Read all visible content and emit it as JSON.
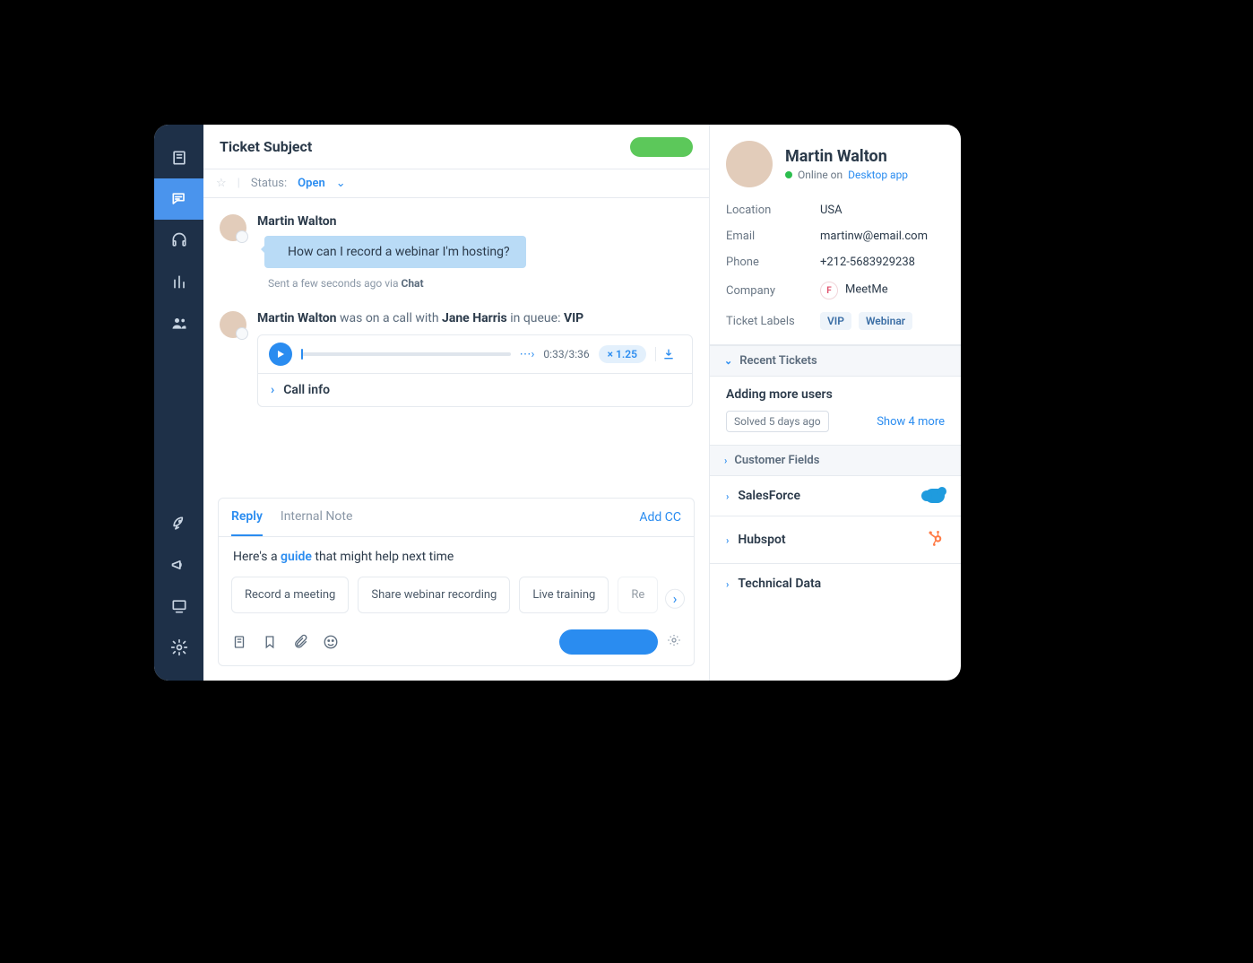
{
  "header": {
    "title": "Ticket Subject",
    "status_prefix": "Status:",
    "status_value": "Open"
  },
  "thread": {
    "message": {
      "author": "Martin Walton",
      "text": "How can I record a webinar I'm hosting?",
      "meta_prefix": "Sent a few seconds ago via ",
      "meta_channel": "Chat"
    },
    "call": {
      "caller": "Martin Walton",
      "line_mid": " was on a call with ",
      "agent": "Jane Harris",
      "line_end": " in queue: ",
      "queue": "VIP",
      "time": "0:33/3:36",
      "speed": "× 1.25",
      "info_label": "Call info"
    }
  },
  "composer": {
    "tabs": {
      "reply": "Reply",
      "note": "Internal Note"
    },
    "add_cc": "Add CC",
    "draft_prefix": "Here's a ",
    "draft_link": "guide",
    "draft_suffix": " that might help next time",
    "suggestions": [
      "Record a meeting",
      "Share webinar recording",
      "Live training",
      "Re"
    ]
  },
  "contact": {
    "name": "Martin Walton",
    "presence_text": "Online on ",
    "presence_link": "Desktop app",
    "fields": {
      "location_label": "Location",
      "location_value": "USA",
      "email_label": "Email",
      "email_value": "martinw@email.com",
      "phone_label": "Phone",
      "phone_value": "+212-5683929238",
      "company_label": "Company",
      "company_value": "MeetMe",
      "company_badge": "F",
      "labels_label": "Ticket Labels",
      "labels": [
        "VIP",
        "Webinar"
      ]
    }
  },
  "sections": {
    "recent_tickets": {
      "header": "Recent Tickets",
      "item": "Adding more users",
      "status": "Solved 5 days ago",
      "show_more": "Show 4 more"
    },
    "customer_fields": "Customer Fields",
    "salesforce": "SalesForce",
    "hubspot": "Hubspot",
    "technical_data": "Technical Data"
  }
}
